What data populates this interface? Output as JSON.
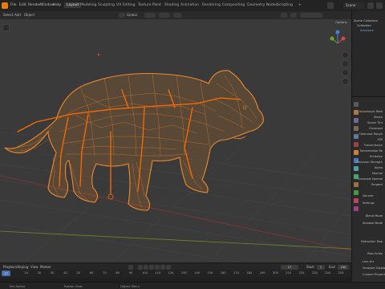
{
  "app": {
    "menus": [
      "File",
      "Edit",
      "Render",
      "Window",
      "Help"
    ],
    "workspaces": [
      "Layout",
      "Modeling",
      "Sculpting",
      "UV Editing",
      "Texture Paint",
      "Shading",
      "Animation",
      "Rendering",
      "Compositing",
      "Geometry Nodes",
      "Scripting"
    ],
    "active_workspace": "Layout",
    "scene": "Scene"
  },
  "viewport_header": {
    "items": [
      "Select",
      "Add",
      "Object"
    ],
    "transform_orientation": "Global",
    "options_label": "Options"
  },
  "outliner": {
    "rows": [
      "Scene Collection",
      "Collection",
      "Armature"
    ]
  },
  "properties": {
    "labels": [
      "Anisotropic Rota",
      "Sheen",
      "Sheen Tint",
      "Clearcoat",
      "Clearcoat Rough",
      "IOR",
      "Transmission",
      "Transmission Ro",
      "Emission",
      "Emission Strength",
      "Alpha",
      "Normal",
      "Clearcoat Normal",
      "Tangent",
      "Volume",
      "Settings",
      "Blend Mode",
      "Shadow Mode",
      "Refraction Dep",
      "Pass Index",
      "Line Art",
      "Viewport Display",
      "Custom Properties"
    ]
  },
  "timeline": {
    "menus": [
      "Playback",
      "Keying",
      "View",
      "Marker"
    ],
    "current_frame": "17",
    "start_label": "Start",
    "start_value": "1",
    "end_label": "End",
    "end_value": "250",
    "ruler_ticks": [
      "0",
      "10",
      "20",
      "30",
      "40",
      "50",
      "60",
      "70",
      "80",
      "90",
      "100",
      "110",
      "120",
      "130",
      "140",
      "150",
      "160",
      "170",
      "180",
      "190",
      "200",
      "210",
      "220",
      "230",
      "240",
      "250"
    ]
  },
  "statusbar": {
    "left": "Set Active",
    "middle": "Rotate View",
    "right": "Object Menu"
  },
  "colors": {
    "wireframe": "#f08a2a",
    "bones": "#ff6a00",
    "grid": "#4a4a4a",
    "x_axis": "#a03a3a",
    "y_axis": "#6f8a2a",
    "accent": "#4772b3"
  }
}
